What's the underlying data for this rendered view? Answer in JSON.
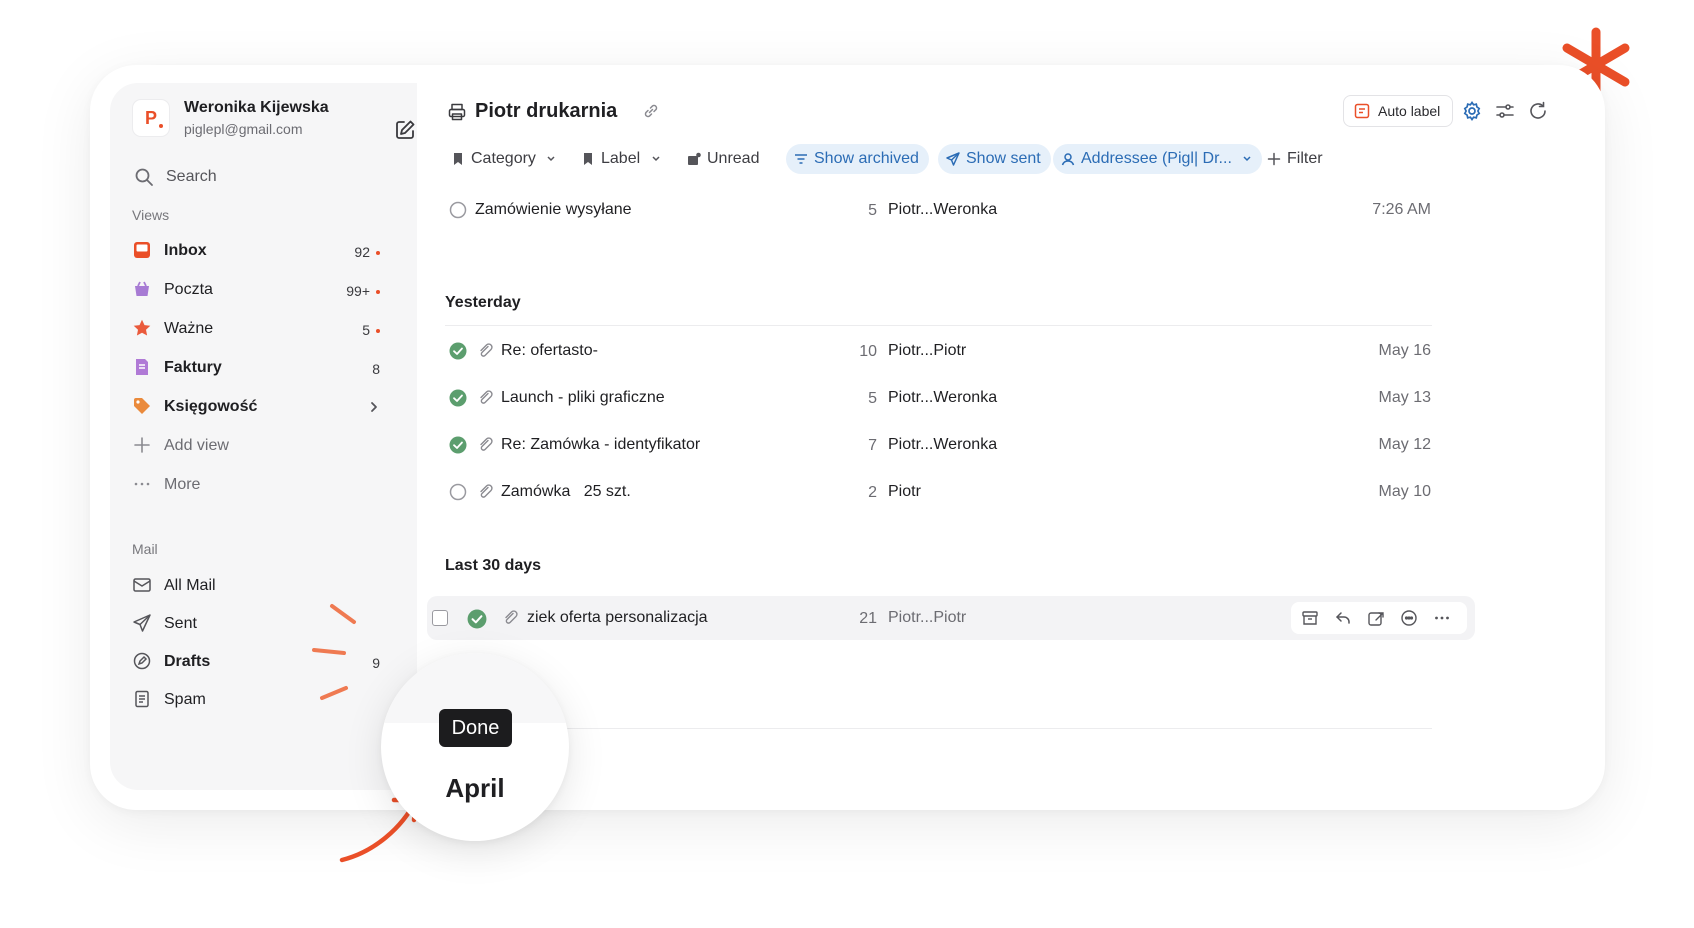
{
  "account": {
    "logo_letter": "P",
    "name": "Weronika Kijewska",
    "email": "piglepl@gmail.com"
  },
  "sidebar": {
    "search_label": "Search",
    "views_label": "Views",
    "views": [
      {
        "label": "Inbox",
        "count": "92",
        "dot": true,
        "icon": "inbox-icon",
        "bold": true
      },
      {
        "label": "Poczta",
        "count": "99+",
        "dot": true,
        "icon": "basket-icon",
        "bold": false
      },
      {
        "label": "Ważne",
        "count": "5",
        "dot": true,
        "icon": "star-icon",
        "bold": false
      },
      {
        "label": "Faktury",
        "count": "8",
        "dot": false,
        "icon": "invoice-icon",
        "bold": true
      },
      {
        "label": "Księgowość",
        "count": "",
        "dot": false,
        "icon": "tag-icon",
        "bold": true
      }
    ],
    "add_view_label": "Add view",
    "more_label": "More",
    "mail_label": "Mail",
    "mail_items": [
      {
        "label": "All Mail",
        "count": "",
        "icon": "all-mail-icon"
      },
      {
        "label": "Sent",
        "count": "",
        "icon": "sent-icon"
      },
      {
        "label": "Drafts",
        "count": "9",
        "icon": "drafts-icon"
      },
      {
        "label": "Spam",
        "count": "",
        "icon": "spam-icon"
      }
    ]
  },
  "header": {
    "title": "Piotr drukarnia",
    "auto_label": "Auto label"
  },
  "filters": {
    "category": "Category",
    "label": "Label",
    "unread": "Unread",
    "show_archived": "Show archived",
    "show_sent": "Show sent",
    "addressee": "Addressee (Pigl| Dr...",
    "add_filter": "Filter"
  },
  "top_row": {
    "subject": "Zamówienie wysyłane",
    "count": "5",
    "from": "Piotr...Weronka",
    "date": "7:26 AM"
  },
  "groups": {
    "yesterday": "Yesterday",
    "last30": "Last 30 days"
  },
  "yesterday_rows": [
    {
      "subject": "Re: ofertasto-",
      "count": "10",
      "from": "Piotr...Piotr",
      "date": "May 16",
      "done": true
    },
    {
      "subject": "Launch - pliki graficzne",
      "count": "5",
      "from": "Piotr...Weronka",
      "date": "May 13",
      "done": true
    },
    {
      "subject": "Re: Zamówka - identyfikator",
      "count": "7",
      "from": "Piotr...Weronka",
      "date": "May 12",
      "done": true
    },
    {
      "subject": "Zamówka   25 szt.",
      "count": "2",
      "from": "Piotr",
      "date": "May 10",
      "done": false
    }
  ],
  "hover_row": {
    "subject": "ziek oferta personalizacja",
    "count": "21",
    "from": "Piotr...Piotr"
  },
  "magnifier": {
    "tooltip": "Done",
    "month": "April"
  },
  "colors": {
    "accent": "#ea4f28",
    "done_green": "#5c9e6e",
    "active_chip_bg": "#e6f0fa",
    "active_chip_text": "#2b6cb5",
    "sidebar_bg": "#f6f6f7"
  }
}
